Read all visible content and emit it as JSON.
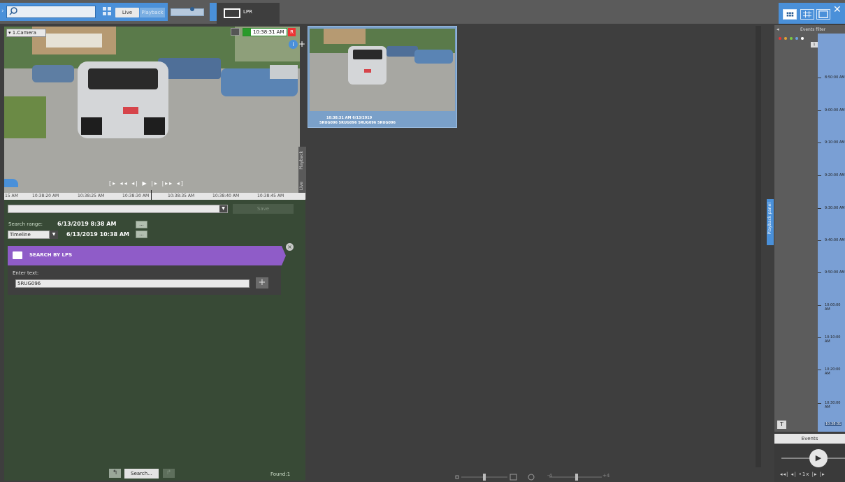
{
  "top_bar": {
    "search_placeholder": "",
    "live_label": "Live",
    "playback_label": "Playback",
    "layout_tab_label": "LPR"
  },
  "camera": {
    "label": "▾ 1.Camera",
    "time": "10:38:31 AM",
    "rec_badge": "R",
    "info_icon": "i",
    "plus_icon": "+",
    "playback_vtab": "Playback",
    "live_vtab": "Live",
    "controls": "[▸ ◂◂ ◂| ▶ |▸ |▸▸ ◂]",
    "timeline_labels": [
      "15 AM",
      "10:38:20 AM",
      "10:38:25 AM",
      "10:38:30 AM",
      "10:38:35 AM",
      "10:38:40 AM",
      "10:38:45 AM"
    ]
  },
  "search_form": {
    "query_value": "",
    "save_label": "Save",
    "range_label": "Search range:",
    "range_from": "6/13/2019   8:38 AM",
    "range_to": "6/13/2019  10:38 AM",
    "range_type": "Timeline",
    "ellipsis": "...",
    "lps_title": "SEARCH BY LPS",
    "lps_enter_label": "Enter text:",
    "lps_value": "5RUG096",
    "lps_add": "+",
    "lps_close": "×",
    "search_button": "Search...",
    "found": "Found:1"
  },
  "result": {
    "caption_time": "10:38:31 AM 6/13/2019",
    "caption_plate": "5RUG096 5RUG096 5RUG096 5RUG096"
  },
  "right_panel": {
    "playback_tab": "Playback panel",
    "events_filter_label": "Events filter",
    "marker": "1",
    "ticks": [
      "8:50:00 AM",
      "9:00:00 AM",
      "9:10:00 AM",
      "9:20:00 AM",
      "9:30:00 AM",
      "9:40:00 AM",
      "9:50:00 AM",
      "10:00:00 AM",
      "10:10:00 AM",
      "10:20:00 AM",
      "10:30:00 AM"
    ],
    "now_label": "10:38:31",
    "t_button": "T",
    "events_tab": "Events",
    "controls": "◂◂| ◂| •1x |▸ |▸",
    "speed": "•1x"
  },
  "bottom_zoom": {
    "minus_label": "-4",
    "plus_label": "+4"
  },
  "colors": {
    "accent": "#4a90d9",
    "form_bg": "#384a36",
    "lps_header": "#8f5cc8",
    "recording": "#e33333",
    "live_green": "#2a9a2a"
  }
}
